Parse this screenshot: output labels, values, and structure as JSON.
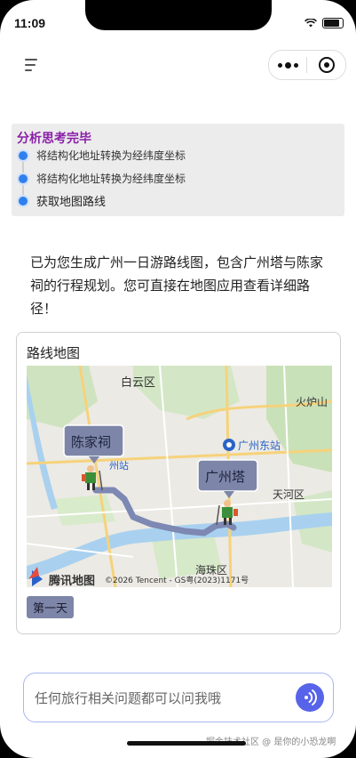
{
  "status_bar": {
    "time": "11:09"
  },
  "header": {
    "menu_icon": "menu-icon",
    "more_icon": "more-dots-icon",
    "close_icon": "target-icon"
  },
  "thinking": {
    "title": "分析思考完毕",
    "steps": [
      "将结构化地址转换为经纬度坐标",
      "将结构化地址转换为经纬度坐标",
      "获取地图路线"
    ],
    "step_color": "#2f80ed",
    "title_color": "#8a1fa8"
  },
  "answer": {
    "text": "已为您生成广州一日游路线图，包含广州塔与陈家祠的行程规划。您可直接在地图应用查看详细路径！"
  },
  "map_card": {
    "title": "路线地图",
    "labels": {
      "baiyun": "白云区",
      "huolushan": "火炉山",
      "guangzhou_east": "广州东站",
      "tianhe": "天河区",
      "haizhu": "海珠区",
      "station_partial": "州站"
    },
    "markers": {
      "chenjiaci": "陈家祠",
      "guangzhouta": "广州塔"
    },
    "logo": "腾讯地图",
    "copyright": "©2026 Tencent - GS粤(2023)1171号",
    "route_color": "#7d88b3",
    "day_tab": "第一天"
  },
  "input": {
    "placeholder": "任何旅行相关问题都可以问我哦",
    "accent": "#5763e8"
  },
  "watermark": "掘金技术社区 @ 是你的小恐龙啊"
}
